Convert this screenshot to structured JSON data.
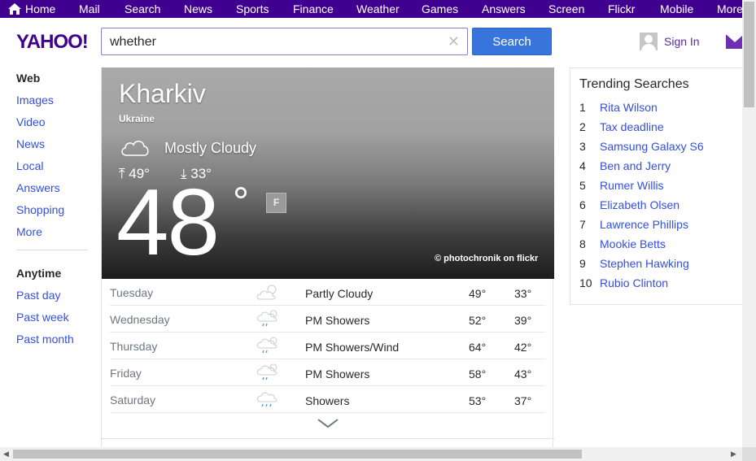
{
  "topnav": {
    "items": [
      "Home",
      "Mail",
      "Search",
      "News",
      "Sports",
      "Finance",
      "Weather",
      "Games",
      "Answers",
      "Screen",
      "Flickr",
      "Mobile",
      "More"
    ]
  },
  "header": {
    "logo": "YAHOO!",
    "search_value": "whether",
    "clear_glyph": "✕",
    "search_button": "Search",
    "signin_label": "Sign In"
  },
  "leftnav": {
    "items": [
      "Web",
      "Images",
      "Video",
      "News",
      "Local",
      "Answers",
      "Shopping",
      "More"
    ],
    "time_label": "Anytime",
    "time_items": [
      "Past day",
      "Past week",
      "Past month"
    ]
  },
  "weather": {
    "city": "Kharkiv",
    "country": "Ukraine",
    "condition": "Mostly Cloudy",
    "high": "49°",
    "low": "33°",
    "current_temp": "48",
    "degree": "°",
    "unit": "F",
    "credit": "©  photochronik on flickr",
    "forecast": [
      {
        "day": "Tuesday",
        "icon": "partly-cloudy-icon",
        "desc": "Partly Cloudy",
        "hi": "49°",
        "lo": "33°"
      },
      {
        "day": "Wednesday",
        "icon": "showers-icon",
        "desc": "PM Showers",
        "hi": "52°",
        "lo": "39°"
      },
      {
        "day": "Thursday",
        "icon": "showers-wind-icon",
        "desc": "PM Showers/Wind",
        "hi": "64°",
        "lo": "42°"
      },
      {
        "day": "Friday",
        "icon": "showers-icon",
        "desc": "PM Showers",
        "hi": "58°",
        "lo": "43°"
      },
      {
        "day": "Saturday",
        "icon": "rain-icon",
        "desc": "Showers",
        "hi": "53°",
        "lo": "37°"
      }
    ]
  },
  "trending": {
    "title": "Trending Searches",
    "items": [
      "Rita Wilson",
      "Tax deadline",
      "Samsung Galaxy S6",
      "Ben and Jerry",
      "Rumer Willis",
      "Elizabeth Olsen",
      "Lawrence Phillips",
      "Mookie Betts",
      "Stephen Hawking",
      "Rubio Clinton"
    ]
  },
  "colors": {
    "brand": "#400090",
    "link": "#324fe1",
    "search_button": "#3775dd"
  }
}
